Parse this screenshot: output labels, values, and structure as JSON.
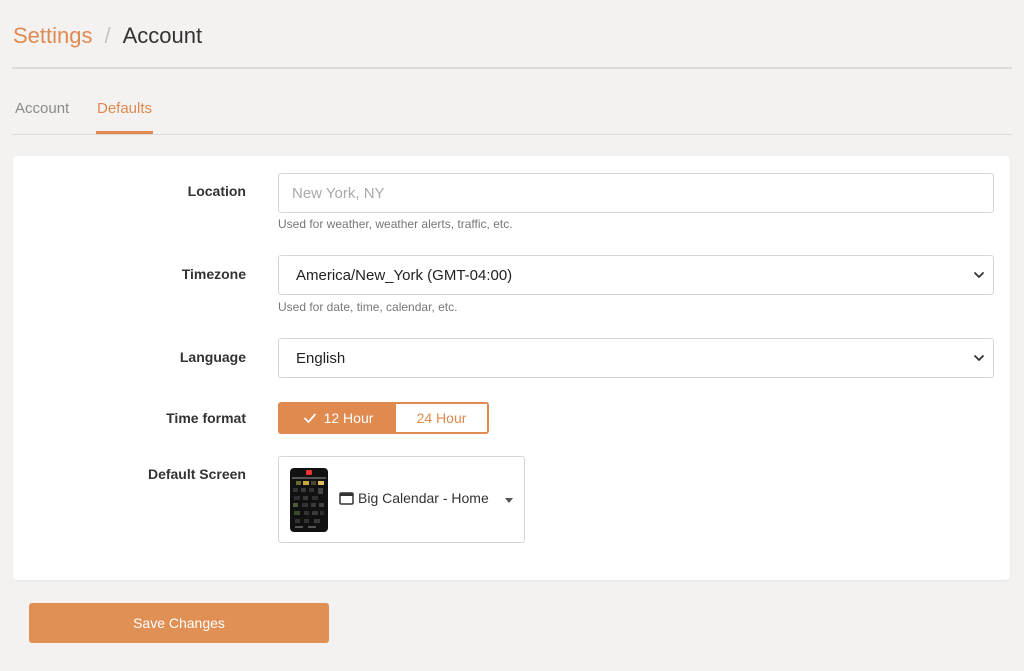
{
  "breadcrumb": {
    "parent": "Settings",
    "separator": "/",
    "current": "Account"
  },
  "tabs": [
    {
      "label": "Account",
      "active": false
    },
    {
      "label": "Defaults",
      "active": true
    }
  ],
  "form": {
    "location": {
      "label": "Location",
      "placeholder": "New York, NY",
      "value": "",
      "help": "Used for weather, weather alerts, traffic, etc."
    },
    "timezone": {
      "label": "Timezone",
      "value": "America/New_York (GMT-04:00)",
      "help": "Used for date, time, calendar, etc."
    },
    "language": {
      "label": "Language",
      "value": "English"
    },
    "time_format": {
      "label": "Time format",
      "options": [
        "12 Hour",
        "24 Hour"
      ],
      "selected": "12 Hour"
    },
    "default_screen": {
      "label": "Default Screen",
      "value": "Big Calendar - Home",
      "icon": "window-icon"
    }
  },
  "save_button": {
    "label": "Save Changes"
  },
  "colors": {
    "accent": "#e08a4f",
    "background": "#f3f2f1",
    "card": "#ffffff",
    "text": "#333333",
    "muted": "#8a8a8a"
  }
}
